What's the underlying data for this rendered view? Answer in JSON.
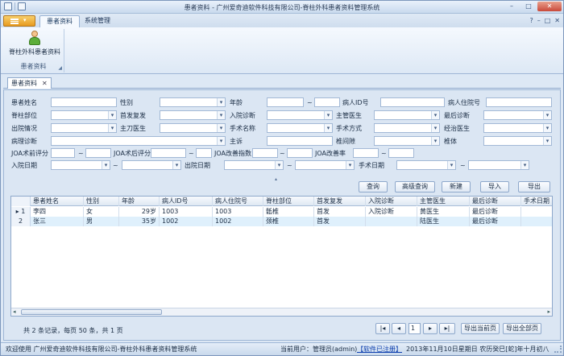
{
  "window": {
    "title": "患者资料 - 广州爱奇迪软件科技有限公司-脊柱外科患者资料管理系统",
    "min": "–",
    "max": "□",
    "close": "✕"
  },
  "ribbon": {
    "tabs": [
      {
        "label": "患者资料"
      },
      {
        "label": "系统管理"
      }
    ],
    "right_help": "?",
    "right_min": "–",
    "right_max": "□",
    "right_close": "✕",
    "button_label": "脊柱外科患者资料",
    "group_label": "患者资料"
  },
  "doc_tab": {
    "label": "患者资料",
    "close": "✕"
  },
  "form": {
    "labels": {
      "name": "患者姓名",
      "gender": "性别",
      "age": "年龄",
      "age_sep": "~",
      "patient_id": "病人ID号",
      "inpatient_no": "病人住院号",
      "spine_part": "脊柱部位",
      "first_recur": "首发复发",
      "admit_diag": "入院诊断",
      "attending": "主管医生",
      "final_diag": "最后诊断",
      "discharge": "出院情况",
      "surgeon": "主刀医生",
      "surgery_name": "手术名称",
      "surgery_method": "手术方式",
      "treating": "经治医生",
      "pathology": "病理诊断",
      "complaint": "主诉",
      "intervertebral": "椎间隙",
      "vertebra": "椎体",
      "joa_pre": "JOA术前评分",
      "joa_pre_sep": "~",
      "joa_post": "JOA术后评分",
      "joa_post_sep": "~",
      "joa_idx": "JOA改善指数",
      "joa_idx_sep": "~",
      "joa_rate": "JOA改善率",
      "joa_rate_sep": "~",
      "admit_date": "入院日期",
      "admit_date_sep": "~",
      "discharge_date": "出院日期",
      "discharge_date_sep": "~",
      "surgery_date": "手术日期",
      "surgery_date_sep": "~"
    }
  },
  "splitter": "▴",
  "actions": {
    "query": "查询",
    "advanced": "高级查询",
    "new": "新建",
    "import": "导入",
    "export": "导出"
  },
  "grid": {
    "columns": [
      "患者姓名",
      "性别",
      "年龄",
      "病人ID号",
      "病人住院号",
      "脊柱部位",
      "首发复发",
      "入院诊断",
      "主管医生",
      "最后诊断",
      "手术日期"
    ],
    "rows": [
      {
        "indicator": "1",
        "marker": "▸",
        "name": "李四",
        "gender": "女",
        "age": "29岁",
        "pid": "1003",
        "ino": "1003",
        "part": "骶椎",
        "recur": "首发",
        "admit": "入院诊断",
        "doctor": "黄医生",
        "final": "最后诊断"
      },
      {
        "indicator": "2",
        "marker": "",
        "name": "张三",
        "gender": "男",
        "age": "35岁",
        "pid": "1002",
        "ino": "1002",
        "part": "颈椎",
        "recur": "首发",
        "admit": "",
        "doctor": "陆医生",
        "final": "最后诊断"
      }
    ],
    "scroll_left": "◂",
    "scroll_right": "▸"
  },
  "pager": {
    "info": "共 2 条记录，每页 50 条，共 1 页",
    "first": "|◂",
    "prev": "◂",
    "page": "1",
    "next": "▸",
    "last": "▸|",
    "export_page": "导出当前页",
    "export_all": "导出全部页"
  },
  "status": {
    "welcome": "欢迎使用 广州爱奇迪软件科技有限公司-脊柱外科患者资料管理系统",
    "user": "当前用户：管理员(admin)",
    "registered": "【软件已注册】",
    "datetime": "2013年11月10日星期日 农历癸巳[蛇]年十月初八"
  }
}
